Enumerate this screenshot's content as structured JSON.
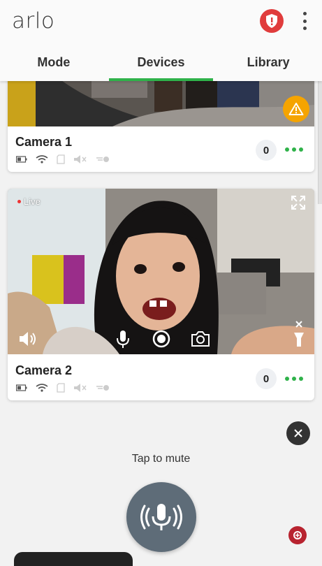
{
  "app": {
    "logo_text": "arlo"
  },
  "tabs": [
    {
      "label": "Mode",
      "active": false
    },
    {
      "label": "Devices",
      "active": true
    },
    {
      "label": "Library",
      "active": false
    }
  ],
  "colors": {
    "accent": "#2fb24a",
    "alert": "#f5a400",
    "shield": "#e03c3c",
    "mic_button": "#5e6c78"
  },
  "cameras": [
    {
      "name": "Camera 1",
      "count": "0",
      "status_icons": [
        "battery-icon",
        "wifi-icon",
        "sd-card-icon",
        "speaker-muted-icon",
        "motion-icon"
      ],
      "alert_icon": "warning-icon"
    },
    {
      "name": "Camera 2",
      "count": "0",
      "live_label": "Live",
      "status_icons": [
        "battery-icon",
        "wifi-icon",
        "sd-card-icon",
        "speaker-muted-icon",
        "motion-icon"
      ],
      "controls": [
        "speaker-icon",
        "microphone-icon",
        "record-icon",
        "camera-snapshot-icon",
        "spotlight-icon"
      ]
    }
  ],
  "bottom": {
    "tap_to_mute": "Tap to mute"
  }
}
